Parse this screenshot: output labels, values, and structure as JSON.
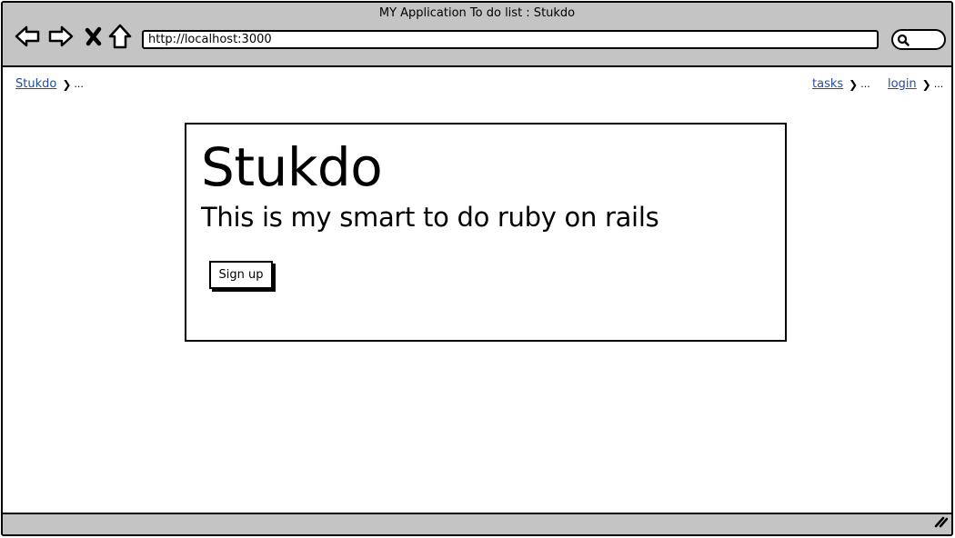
{
  "window": {
    "title": "MY Application To do list : Stukdo",
    "url": "http://localhost:3000"
  },
  "toolbar": {
    "icons": [
      "back-arrow-icon",
      "forward-arrow-icon",
      "close-x-icon",
      "home-icon",
      "search-icon",
      "resize-grip-icon"
    ]
  },
  "breadcrumb": {
    "left": {
      "label": "Stukdo",
      "separator": "❯",
      "ellipsis": "..."
    },
    "right": [
      {
        "label": "tasks",
        "separator": "❯",
        "ellipsis": "..."
      },
      {
        "label": "login",
        "separator": "❯",
        "ellipsis": "..."
      }
    ]
  },
  "hero": {
    "title": "Stukdo",
    "subtitle": "This is my smart to do ruby on rails",
    "signup_label": "Sign up"
  },
  "colors": {
    "chrome_bg": "#c4c4c4",
    "link": "#1f4e9c",
    "border": "#000000",
    "page_bg": "#ffffff"
  }
}
